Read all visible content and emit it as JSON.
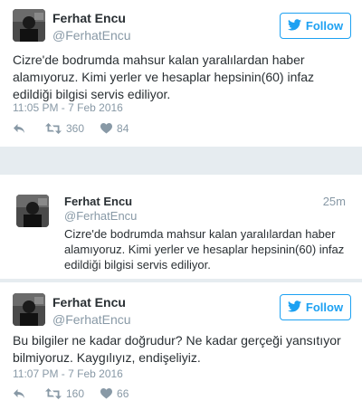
{
  "tweets": [
    {
      "name": "Ferhat Encu",
      "handle": "@FerhatEncu",
      "follow_label": "Follow",
      "text": "Cizre'de bodrumda mahsur kalan yaralılardan haber alamıyoruz. Kimi yerler ve hesaplar hepsinin(60) infaz edildiği bilgisi servis ediliyor.",
      "time": "11:05 PM - 7 Feb 2016",
      "retweets": "360",
      "likes": "84"
    },
    {
      "name": "Ferhat Encu",
      "handle": "@FerhatEncu",
      "ago": "25m",
      "text": "Cizre'de bodrumda mahsur kalan yaralılardan haber alamıyoruz. Kimi yerler ve hesaplar hepsinin(60) infaz edildiği bilgisi servis ediliyor."
    },
    {
      "name": "Ferhat Encu",
      "handle": "@FerhatEncu",
      "follow_label": "Follow",
      "text": "Bu bilgiler ne kadar doğrudur? Ne kadar gerçeği yansıtıyor bilmiyoruz. Kaygılıyız, endişeliyiz.",
      "time": "11:07 PM - 7 Feb 2016",
      "retweets": "160",
      "likes": "66"
    }
  ],
  "colors": {
    "accent": "#1da1f2",
    "muted": "#8899a6",
    "text": "#292f33",
    "background": "#e6ecf0"
  },
  "icons": {
    "bird": "twitter-bird-icon",
    "reply": "reply-icon",
    "retweet": "retweet-icon",
    "like": "heart-icon"
  }
}
